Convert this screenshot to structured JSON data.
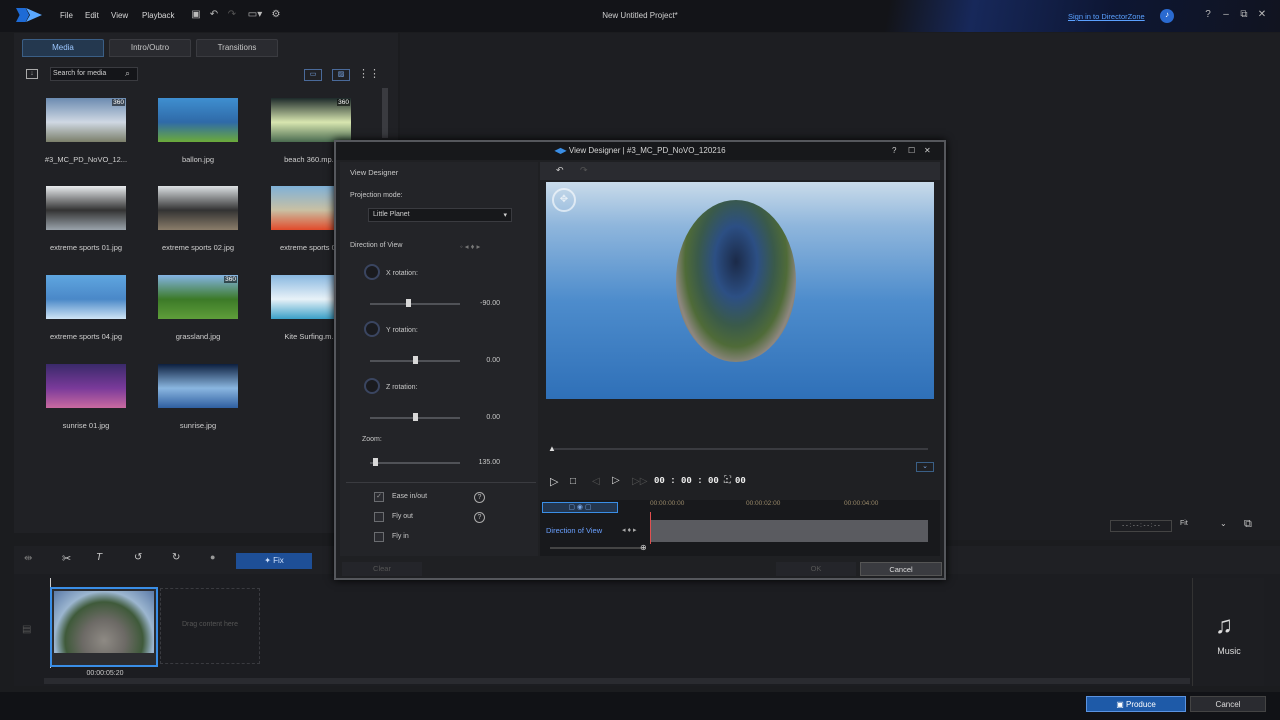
{
  "app": {
    "title": "New Untitled Project*",
    "sign_in": "Sign in to DirectorZone",
    "menu": [
      "File",
      "Edit",
      "View",
      "Playback"
    ]
  },
  "left_panel": {
    "tabs": [
      "Media",
      "Intro/Outro",
      "Transitions"
    ],
    "search_placeholder": "Search for media",
    "media": [
      {
        "name": "#3_MC_PD_NoVO_12...",
        "badge": "360",
        "colors": [
          "#6b8bb1",
          "#7b7f6a",
          "#cfd8e3"
        ]
      },
      {
        "name": "ballon.jpg",
        "badge": "",
        "colors": [
          "#3f8fd0",
          "#6cab3a",
          "#2f6aa8"
        ]
      },
      {
        "name": "beach 360.mp...",
        "badge": "360",
        "colors": [
          "#1d2a2a",
          "#4a6b50",
          "#d8e6b0"
        ]
      },
      {
        "name": "extreme sports 01.jpg",
        "badge": "",
        "colors": [
          "#e9ecef",
          "#9aa3ab",
          "#333"
        ]
      },
      {
        "name": "extreme sports 02.jpg",
        "badge": "",
        "colors": [
          "#dce1e4",
          "#8a7d6a",
          "#333"
        ]
      },
      {
        "name": "extreme sports 0...",
        "badge": "",
        "colors": [
          "#7fb1d8",
          "#e24a2a",
          "#c9c0a3"
        ]
      },
      {
        "name": "extreme sports 04.jpg",
        "badge": "",
        "colors": [
          "#5fa6e0",
          "#cfe4f5",
          "#4a88c8"
        ]
      },
      {
        "name": "grassland.jpg",
        "badge": "360",
        "colors": [
          "#84b4e4",
          "#5f9e3a",
          "#3c7a28"
        ]
      },
      {
        "name": "Kite Surfing.m...",
        "badge": "",
        "colors": [
          "#89b8e0",
          "#3aa0c8",
          "#e8f2f8"
        ]
      },
      {
        "name": "sunrise 01.jpg",
        "badge": "",
        "colors": [
          "#3a2a6a",
          "#c96aa0",
          "#7a3a9a"
        ]
      },
      {
        "name": "sunrise.jpg",
        "badge": "",
        "colors": [
          "#0c1f3f",
          "#2f5fa0",
          "#8ab6e0"
        ]
      }
    ]
  },
  "toolbar": {
    "fix": "Fix"
  },
  "timeline": {
    "clip_time": "00:00:05:20",
    "drag_hint": "Drag content here",
    "music": "Music"
  },
  "playbar": {
    "fit": "Fit",
    "time": "- - : - - : - - : - -"
  },
  "bottom": {
    "produce": "Produce",
    "cancel": "Cancel"
  },
  "dialog": {
    "title": "View Designer  |  #3_MC_PD_NoVO_120216",
    "header": "View Designer",
    "projection_label": "Projection mode:",
    "projection_value": "Little Planet",
    "direction_label": "Direction of View",
    "x_label": "X rotation:",
    "x_value": "-90.00",
    "x_level": 0.42,
    "y_label": "Y rotation:",
    "y_value": "0.00",
    "y_level": 0.5,
    "z_label": "Z rotation:",
    "z_value": "0.00",
    "z_level": 0.5,
    "zoom_label": "Zoom:",
    "zoom_value": "135.00",
    "zoom_level": 0.05,
    "ease": "Ease in/out",
    "flyout": "Fly out",
    "flyin": "Fly in",
    "timecode": "00 : 00 : 00 : 00",
    "tl_marks": [
      "00:00:00:00",
      "00:00:02:00",
      "00:00:04:00"
    ],
    "tl_track": "Direction of View",
    "clear": "Clear",
    "ok": "OK",
    "cancel": "Cancel"
  }
}
